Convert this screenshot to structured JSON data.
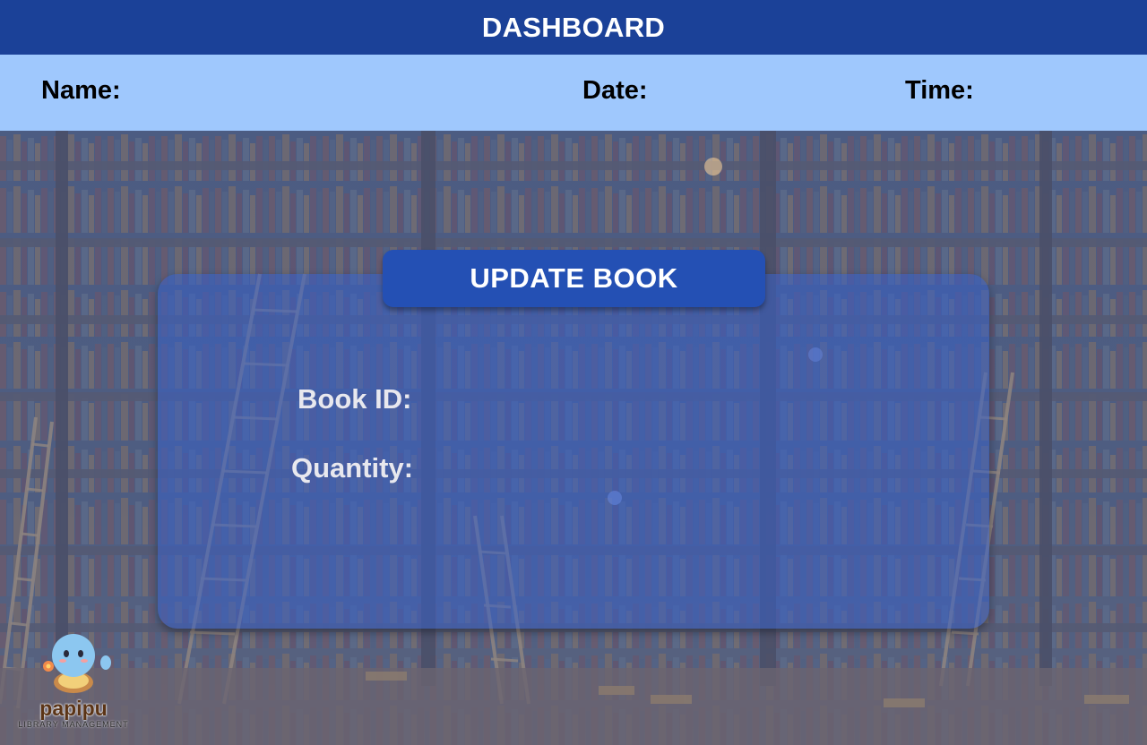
{
  "header": {
    "title": "DASHBOARD"
  },
  "infobar": {
    "name_label": "Name:",
    "date_label": "Date:",
    "time_label": "Time:"
  },
  "panel": {
    "title": "UPDATE BOOK",
    "book_id_label": "Book ID:",
    "quantity_label": "Quantity:"
  },
  "logo": {
    "name": "papipu",
    "subtitle": "LIBRARY MANAGEMENT"
  },
  "colors": {
    "header_bg": "#1b4198",
    "infobar_bg": "#9fc8fd",
    "panel_title_bg": "#2450b4"
  }
}
